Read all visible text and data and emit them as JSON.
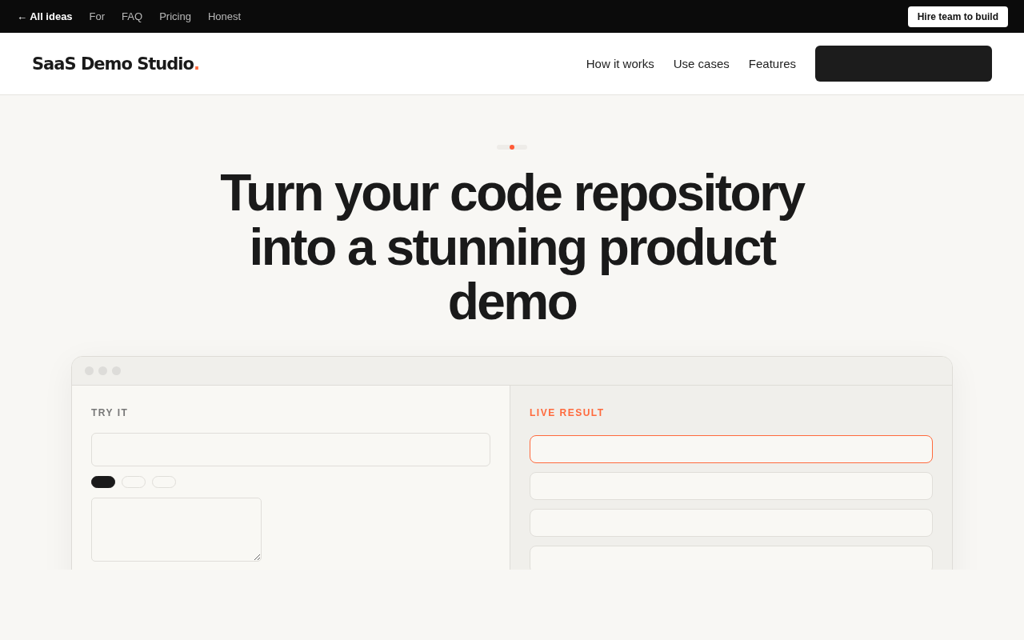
{
  "topbar": {
    "back_link": "← All ideas",
    "links": [
      "For",
      "FAQ",
      "Pricing",
      "Honest"
    ],
    "cta": "Hire team to build"
  },
  "header": {
    "logo": "SaaS Demo Studio",
    "logo_dot": ".",
    "nav": [
      "How it works",
      "Use cases",
      "Features"
    ]
  },
  "hero": {
    "heading": "Turn your code repository into a stunning product demo"
  },
  "demo": {
    "left": {
      "label": "TRY IT",
      "chips": [
        {
          "selected": true
        },
        {
          "selected": false
        },
        {
          "selected": false
        }
      ]
    },
    "right": {
      "label": "LIVE RESULT",
      "results": [
        {
          "selected": true
        },
        {
          "selected": false
        },
        {
          "selected": false
        },
        {
          "selected": false
        }
      ]
    }
  }
}
